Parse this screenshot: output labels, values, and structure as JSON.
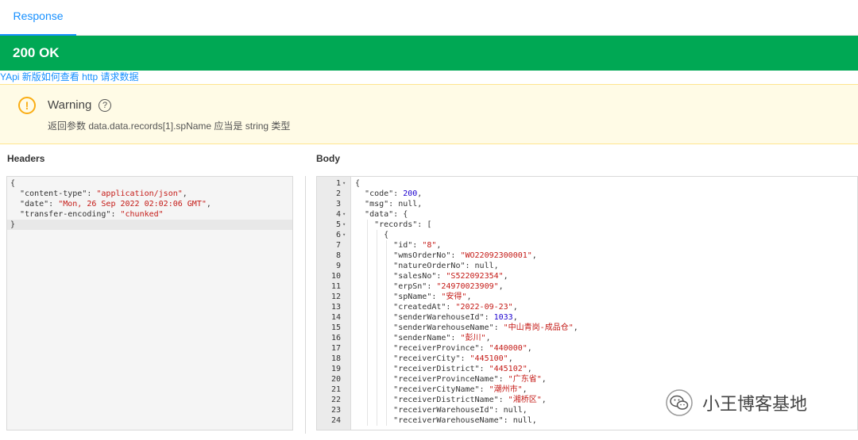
{
  "tabs": {
    "response_label": "Response"
  },
  "status": {
    "text": "200 OK",
    "color": "#00a854"
  },
  "help_link": {
    "text": "YApi 新版如何查看 http 请求数据"
  },
  "warning": {
    "title": "Warning",
    "help_icon": "question-circle-icon",
    "message": "返回参数 data.data.records[1].spName 应当是 string 类型"
  },
  "headers": {
    "label": "Headers",
    "lines": [
      [
        {
          "t": "p",
          "v": "{"
        }
      ],
      [
        {
          "t": "p",
          "v": "  "
        },
        {
          "t": "k",
          "v": "\"content-type\""
        },
        {
          "t": "p",
          "v": ": "
        },
        {
          "t": "s",
          "v": "\"application/json\""
        },
        {
          "t": "p",
          "v": ","
        }
      ],
      [
        {
          "t": "p",
          "v": "  "
        },
        {
          "t": "k",
          "v": "\"date\""
        },
        {
          "t": "p",
          "v": ": "
        },
        {
          "t": "s",
          "v": "\"Mon, 26 Sep 2022 02:02:06 GMT\""
        },
        {
          "t": "p",
          "v": ","
        }
      ],
      [
        {
          "t": "p",
          "v": "  "
        },
        {
          "t": "k",
          "v": "\"transfer-encoding\""
        },
        {
          "t": "p",
          "v": ": "
        },
        {
          "t": "s",
          "v": "\"chunked\""
        }
      ],
      [
        {
          "t": "p",
          "v": "}"
        }
      ]
    ]
  },
  "body": {
    "label": "Body",
    "lines": [
      {
        "n": "1",
        "fold": true,
        "d": 0,
        "tokens": [
          {
            "t": "p",
            "v": "{"
          }
        ]
      },
      {
        "n": "2",
        "fold": false,
        "d": 1,
        "tokens": [
          {
            "t": "k",
            "v": "\"code\""
          },
          {
            "t": "p",
            "v": ": "
          },
          {
            "t": "n",
            "v": "200"
          },
          {
            "t": "p",
            "v": ","
          }
        ]
      },
      {
        "n": "3",
        "fold": false,
        "d": 1,
        "tokens": [
          {
            "t": "k",
            "v": "\"msg\""
          },
          {
            "t": "p",
            "v": ": null,"
          }
        ]
      },
      {
        "n": "4",
        "fold": true,
        "d": 1,
        "tokens": [
          {
            "t": "k",
            "v": "\"data\""
          },
          {
            "t": "p",
            "v": ": {"
          }
        ]
      },
      {
        "n": "5",
        "fold": true,
        "d": 2,
        "tokens": [
          {
            "t": "k",
            "v": "\"records\""
          },
          {
            "t": "p",
            "v": ": ["
          }
        ]
      },
      {
        "n": "6",
        "fold": true,
        "d": 3,
        "tokens": [
          {
            "t": "p",
            "v": "{"
          }
        ]
      },
      {
        "n": "7",
        "fold": false,
        "d": 4,
        "tokens": [
          {
            "t": "k",
            "v": "\"id\""
          },
          {
            "t": "p",
            "v": ": "
          },
          {
            "t": "s",
            "v": "\"8\""
          },
          {
            "t": "p",
            "v": ","
          }
        ]
      },
      {
        "n": "8",
        "fold": false,
        "d": 4,
        "tokens": [
          {
            "t": "k",
            "v": "\"wmsOrderNo\""
          },
          {
            "t": "p",
            "v": ": "
          },
          {
            "t": "s",
            "v": "\"WO22092300001\""
          },
          {
            "t": "p",
            "v": ","
          }
        ]
      },
      {
        "n": "9",
        "fold": false,
        "d": 4,
        "tokens": [
          {
            "t": "k",
            "v": "\"natureOrderNo\""
          },
          {
            "t": "p",
            "v": ": null,"
          }
        ]
      },
      {
        "n": "10",
        "fold": false,
        "d": 4,
        "tokens": [
          {
            "t": "k",
            "v": "\"salesNo\""
          },
          {
            "t": "p",
            "v": ": "
          },
          {
            "t": "s",
            "v": "\"S522092354\""
          },
          {
            "t": "p",
            "v": ","
          }
        ]
      },
      {
        "n": "11",
        "fold": false,
        "d": 4,
        "tokens": [
          {
            "t": "k",
            "v": "\"erpSn\""
          },
          {
            "t": "p",
            "v": ": "
          },
          {
            "t": "s",
            "v": "\"24970023909\""
          },
          {
            "t": "p",
            "v": ","
          }
        ]
      },
      {
        "n": "12",
        "fold": false,
        "d": 4,
        "tokens": [
          {
            "t": "k",
            "v": "\"spName\""
          },
          {
            "t": "p",
            "v": ": "
          },
          {
            "t": "s",
            "v": "\"安得\""
          },
          {
            "t": "p",
            "v": ","
          }
        ]
      },
      {
        "n": "13",
        "fold": false,
        "d": 4,
        "tokens": [
          {
            "t": "k",
            "v": "\"createdAt\""
          },
          {
            "t": "p",
            "v": ": "
          },
          {
            "t": "s",
            "v": "\"2022-09-23\""
          },
          {
            "t": "p",
            "v": ","
          }
        ]
      },
      {
        "n": "14",
        "fold": false,
        "d": 4,
        "tokens": [
          {
            "t": "k",
            "v": "\"senderWarehouseId\""
          },
          {
            "t": "p",
            "v": ": "
          },
          {
            "t": "n",
            "v": "1033"
          },
          {
            "t": "p",
            "v": ","
          }
        ]
      },
      {
        "n": "15",
        "fold": false,
        "d": 4,
        "tokens": [
          {
            "t": "k",
            "v": "\"senderWarehouseName\""
          },
          {
            "t": "p",
            "v": ": "
          },
          {
            "t": "s",
            "v": "\"中山青岗-成品仓\""
          },
          {
            "t": "p",
            "v": ","
          }
        ]
      },
      {
        "n": "16",
        "fold": false,
        "d": 4,
        "tokens": [
          {
            "t": "k",
            "v": "\"senderName\""
          },
          {
            "t": "p",
            "v": ": "
          },
          {
            "t": "s",
            "v": "\"彭川\""
          },
          {
            "t": "p",
            "v": ","
          }
        ]
      },
      {
        "n": "17",
        "fold": false,
        "d": 4,
        "tokens": [
          {
            "t": "k",
            "v": "\"receiverProvince\""
          },
          {
            "t": "p",
            "v": ": "
          },
          {
            "t": "s",
            "v": "\"440000\""
          },
          {
            "t": "p",
            "v": ","
          }
        ]
      },
      {
        "n": "18",
        "fold": false,
        "d": 4,
        "tokens": [
          {
            "t": "k",
            "v": "\"receiverCity\""
          },
          {
            "t": "p",
            "v": ": "
          },
          {
            "t": "s",
            "v": "\"445100\""
          },
          {
            "t": "p",
            "v": ","
          }
        ]
      },
      {
        "n": "19",
        "fold": false,
        "d": 4,
        "tokens": [
          {
            "t": "k",
            "v": "\"receiverDistrict\""
          },
          {
            "t": "p",
            "v": ": "
          },
          {
            "t": "s",
            "v": "\"445102\""
          },
          {
            "t": "p",
            "v": ","
          }
        ]
      },
      {
        "n": "20",
        "fold": false,
        "d": 4,
        "tokens": [
          {
            "t": "k",
            "v": "\"receiverProvinceName\""
          },
          {
            "t": "p",
            "v": ": "
          },
          {
            "t": "s",
            "v": "\"广东省\""
          },
          {
            "t": "p",
            "v": ","
          }
        ]
      },
      {
        "n": "21",
        "fold": false,
        "d": 4,
        "tokens": [
          {
            "t": "k",
            "v": "\"receiverCityName\""
          },
          {
            "t": "p",
            "v": ": "
          },
          {
            "t": "s",
            "v": "\"潮州市\""
          },
          {
            "t": "p",
            "v": ","
          }
        ]
      },
      {
        "n": "22",
        "fold": false,
        "d": 4,
        "tokens": [
          {
            "t": "k",
            "v": "\"receiverDistrictName\""
          },
          {
            "t": "p",
            "v": ": "
          },
          {
            "t": "s",
            "v": "\"湘桥区\""
          },
          {
            "t": "p",
            "v": ","
          }
        ]
      },
      {
        "n": "23",
        "fold": false,
        "d": 4,
        "tokens": [
          {
            "t": "k",
            "v": "\"receiverWarehouseId\""
          },
          {
            "t": "p",
            "v": ": null,"
          }
        ]
      },
      {
        "n": "24",
        "fold": false,
        "d": 4,
        "tokens": [
          {
            "t": "k",
            "v": "\"receiverWarehouseName\""
          },
          {
            "t": "p",
            "v": ": null,"
          }
        ]
      }
    ]
  },
  "watermark": {
    "text": "小王博客基地",
    "icon": "wechat-icon"
  }
}
